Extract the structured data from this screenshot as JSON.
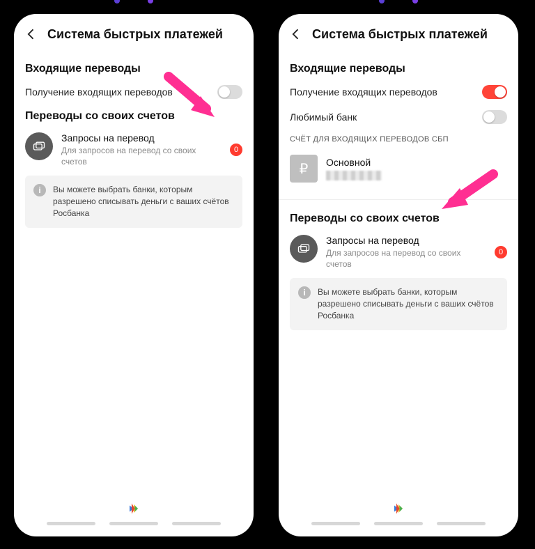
{
  "screens": {
    "left": {
      "header": {
        "title": "Система быстрых платежей"
      },
      "incoming": {
        "heading": "Входящие переводы",
        "toggle_label": "Получение входящих переводов",
        "toggle_on": false
      },
      "own_transfers": {
        "heading": "Переводы со своих счетов",
        "item_title": "Запросы на перевод",
        "item_sub": "Для запросов на перевод со своих счетов",
        "badge": "0"
      },
      "infobox": "Вы можете выбрать банки, которым разрешено списывать деньги с ваших счётов Росбанка"
    },
    "right": {
      "header": {
        "title": "Система быстрых платежей"
      },
      "incoming": {
        "heading": "Входящие переводы",
        "toggle_label": "Получение входящих переводов",
        "toggle_on": true,
        "fav_label": "Любимый банк",
        "fav_on": false,
        "account_heading": "СЧЁТ ДЛЯ ВХОДЯЩИХ ПЕРЕВОДОВ СБП",
        "account_name": "Основной"
      },
      "own_transfers": {
        "heading": "Переводы со своих счетов",
        "item_title": "Запросы на перевод",
        "item_sub": "Для запросов на перевод со своих счетов",
        "badge": "0"
      },
      "infobox": "Вы можете выбрать банки, которым разрешено списывать деньги с ваших счётов Росбанка"
    }
  },
  "icons": {
    "ruble": "₽",
    "info": "i"
  }
}
